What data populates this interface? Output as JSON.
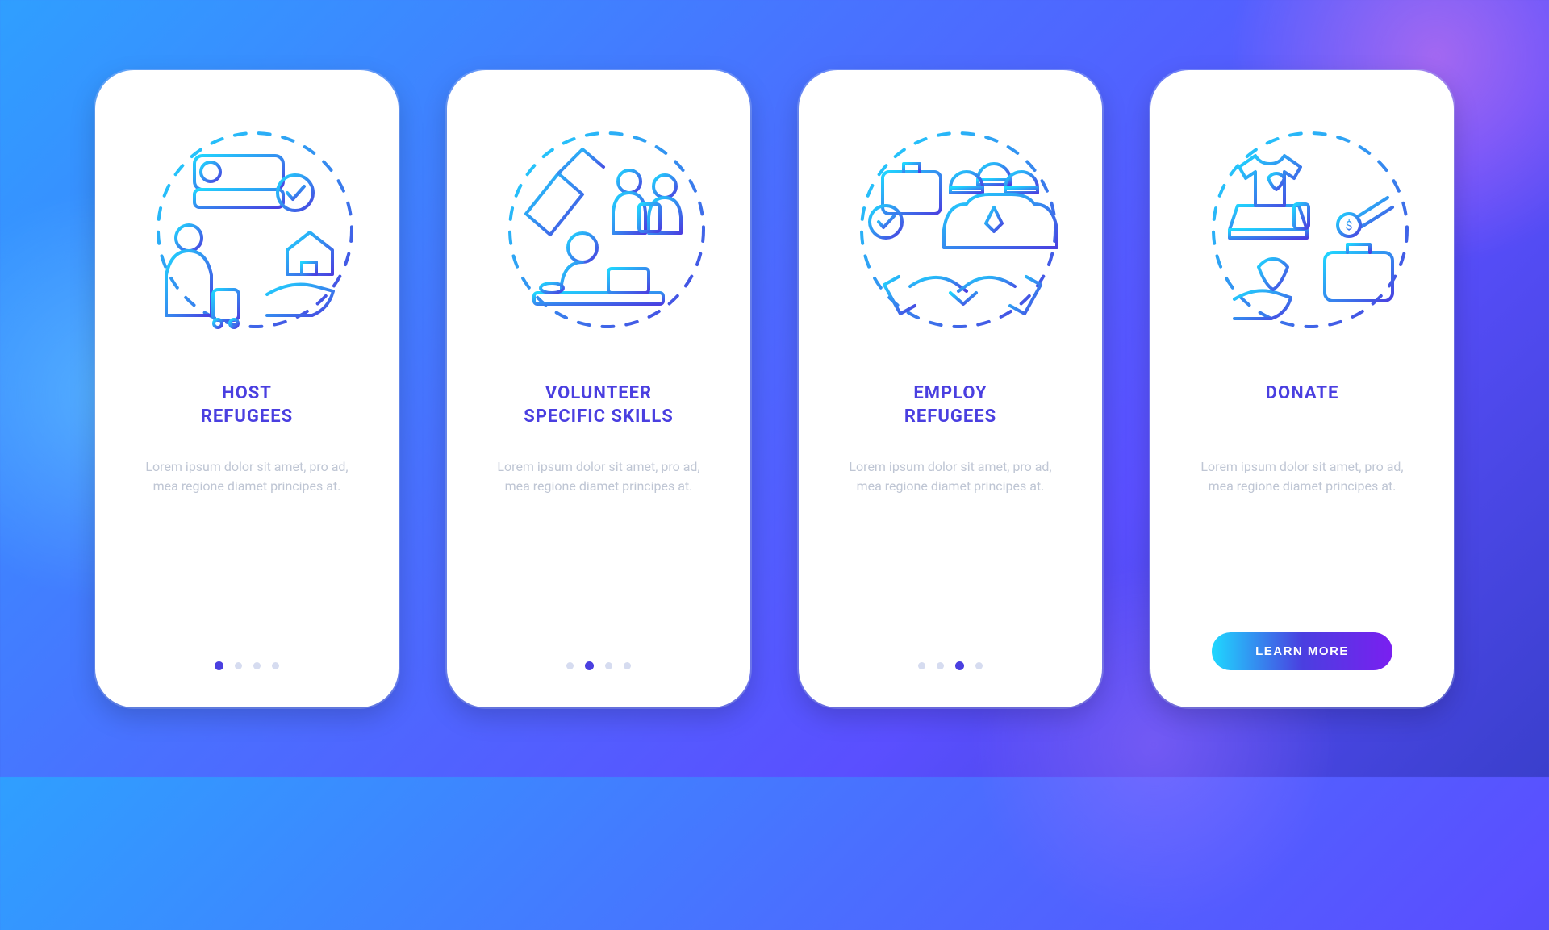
{
  "lorem": "Lorem ipsum dolor sit amet, pro ad, mea regione diamet principes at.",
  "cta_label": "LEARN MORE",
  "colors": {
    "title": "#4a3fe0",
    "grad_start": "#1fd8ff",
    "grad_end": "#4a3fe0"
  },
  "screens": [
    {
      "title": "HOST\nREFUGEES",
      "icon": "host-refugees-icon",
      "active_dot": 0,
      "footer_type": "dots"
    },
    {
      "title": "VOLUNTEER\nSPECIFIC SKILLS",
      "icon": "volunteer-skills-icon",
      "active_dot": 1,
      "footer_type": "dots"
    },
    {
      "title": "EMPLOY\nREFUGEES",
      "icon": "employ-refugees-icon",
      "active_dot": 2,
      "footer_type": "dots"
    },
    {
      "title": "DONATE",
      "icon": "donate-icon",
      "active_dot": 3,
      "footer_type": "cta"
    }
  ]
}
